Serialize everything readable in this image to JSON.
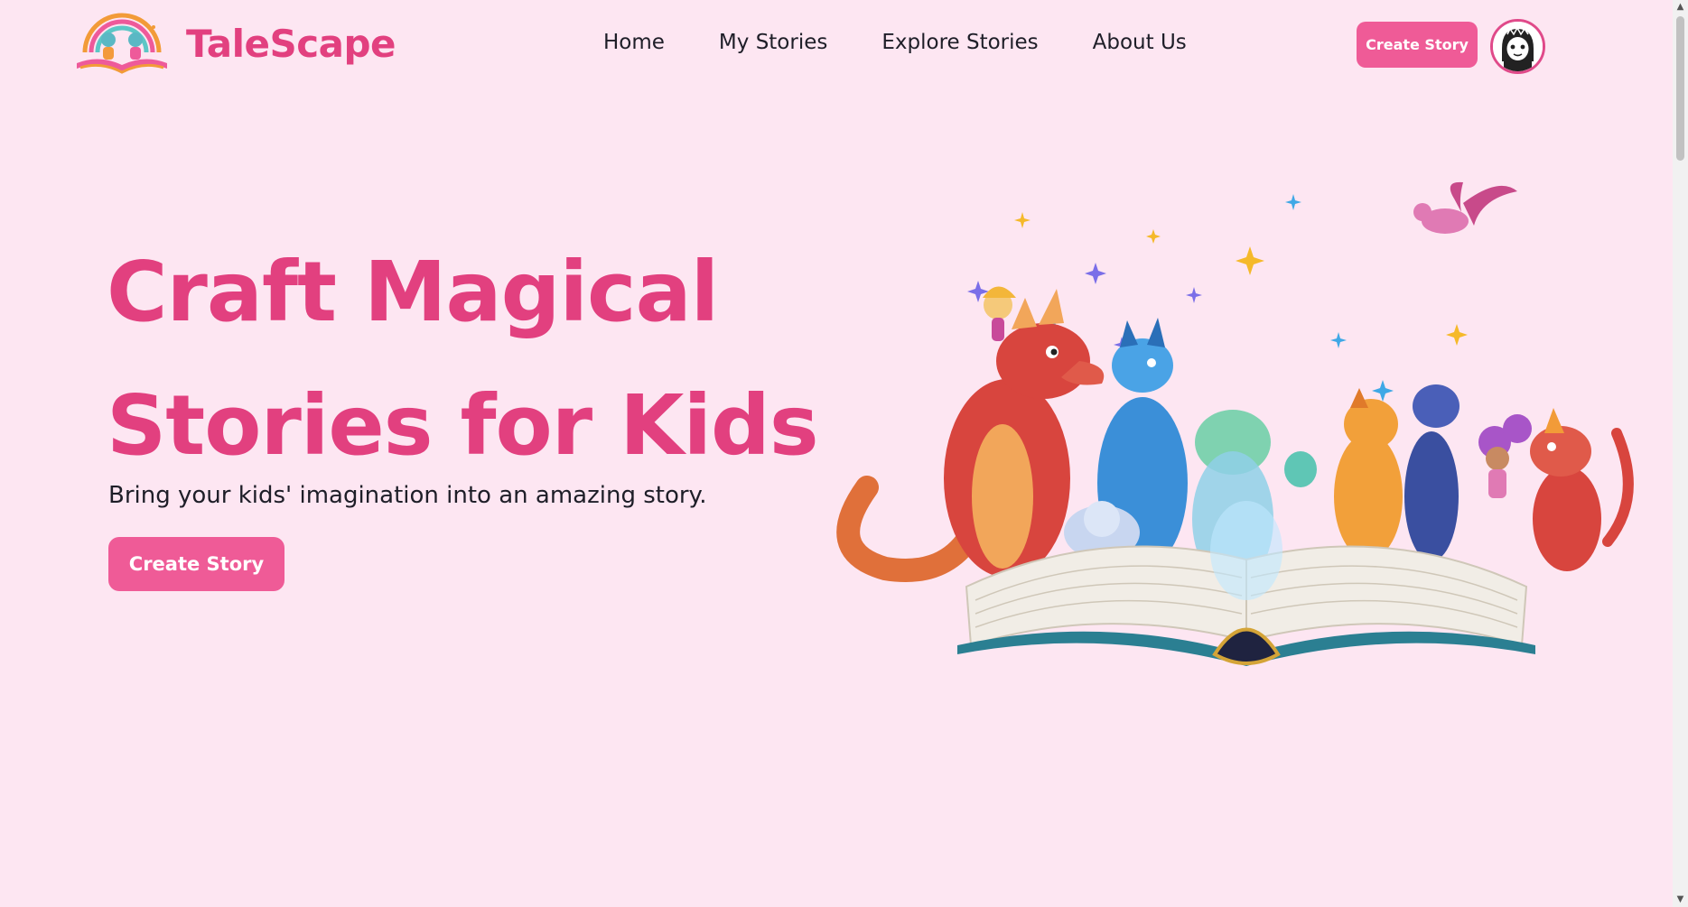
{
  "header": {
    "brand": "TaleScape",
    "nav": [
      "Home",
      "My Stories",
      "Explore Stories",
      "About Us"
    ],
    "cta_label": "Create Story"
  },
  "hero": {
    "title_line1": "Craft Magical",
    "title_line2": "Stories for Kids",
    "subtitle": "Bring your kids' imagination into an amazing story.",
    "cta_label": "Create Story"
  },
  "colors": {
    "background": "#fde6f2",
    "accent": "#e2407f",
    "button": "#ef5b97",
    "text": "#1e1e28"
  },
  "icons": [
    "talescape-logo-icon",
    "user-avatar-icon",
    "storybook-dragons-illustration"
  ]
}
